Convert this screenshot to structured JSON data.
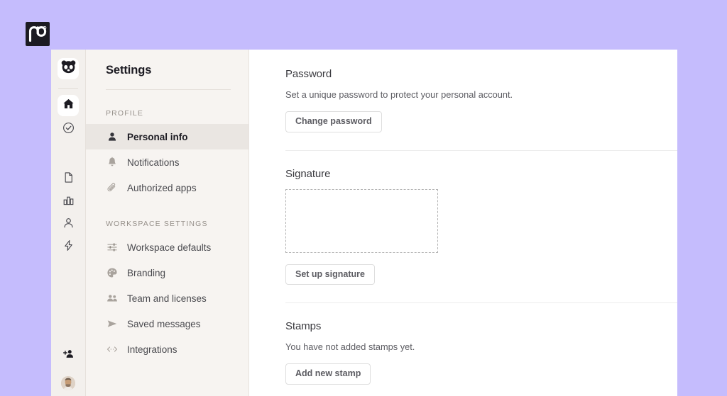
{
  "brand": {
    "logo_text": "pd",
    "logo_mark": "pandadoc-logo",
    "registered_mark": "®"
  },
  "icon_rail": {
    "top_items": [
      {
        "name": "panda-logo-icon",
        "label": "Panda workspace",
        "active": true
      }
    ],
    "nav_items": [
      {
        "name": "home-icon",
        "label": "Home",
        "active": true
      },
      {
        "name": "check-circle-icon",
        "label": "Tasks",
        "active": false
      }
    ],
    "tool_items": [
      {
        "name": "document-icon",
        "label": "Documents",
        "active": false
      },
      {
        "name": "chart-bar-icon",
        "label": "Reporting",
        "active": false
      },
      {
        "name": "person-icon",
        "label": "Contacts",
        "active": false
      },
      {
        "name": "lightning-bolt-icon",
        "label": "Automation",
        "active": false
      }
    ],
    "bottom_items": [
      {
        "name": "add-user-icon",
        "label": "Invite people"
      },
      {
        "name": "avatar",
        "label": "Account"
      }
    ]
  },
  "settings_nav": {
    "title": "Settings",
    "groups": [
      {
        "label": "PROFILE",
        "items": [
          {
            "label": "Personal info",
            "icon": "person-filled-icon",
            "active": true
          },
          {
            "label": "Notifications",
            "icon": "bell-icon",
            "active": false
          },
          {
            "label": "Authorized apps",
            "icon": "paperclip-icon",
            "active": false
          }
        ]
      },
      {
        "label": "WORKSPACE SETTINGS",
        "items": [
          {
            "label": "Workspace defaults",
            "icon": "sliders-icon",
            "active": false
          },
          {
            "label": "Branding",
            "icon": "palette-icon",
            "active": false
          },
          {
            "label": "Team and licenses",
            "icon": "people-icon",
            "active": false
          },
          {
            "label": "Saved messages",
            "icon": "send-icon",
            "active": false
          },
          {
            "label": "Integrations",
            "icon": "code-brackets-icon",
            "active": false
          }
        ]
      }
    ]
  },
  "main": {
    "password": {
      "title": "Password",
      "description": "Set a unique password to protect your personal account.",
      "button": "Change password"
    },
    "signature": {
      "title": "Signature",
      "preview_empty": true,
      "button": "Set up signature"
    },
    "stamps": {
      "title": "Stamps",
      "description": "You have not added stamps yet.",
      "button": "Add new stamp"
    }
  },
  "colors": {
    "page_background": "#c5bcfd",
    "rail_background": "#f3f0ed",
    "nav_background": "#f7f4f1",
    "content_background": "#ffffff",
    "active_nav_background": "#eae6e2",
    "text_primary": "#1c1b22",
    "text_secondary": "#5c5c62",
    "text_muted": "#96908a"
  }
}
